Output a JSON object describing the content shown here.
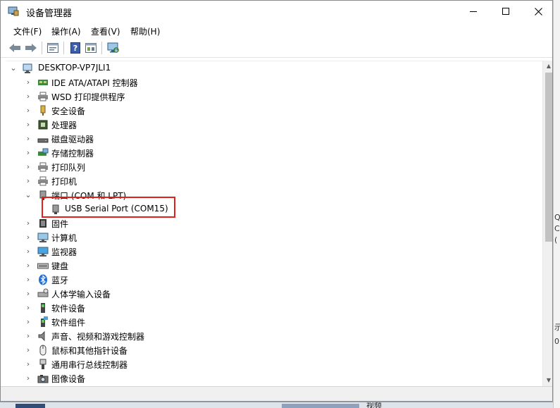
{
  "window": {
    "title": "设备管理器"
  },
  "menu": [
    {
      "label": "文件(F)"
    },
    {
      "label": "操作(A)"
    },
    {
      "label": "查看(V)"
    },
    {
      "label": "帮助(H)"
    }
  ],
  "toolbar": [
    {
      "icon": "back-arrow-icon"
    },
    {
      "icon": "forward-arrow-icon"
    },
    {
      "icon": "properties-icon"
    },
    {
      "icon": "help-icon"
    },
    {
      "icon": "show-hidden-icon"
    },
    {
      "icon": "scan-hardware-icon"
    }
  ],
  "tree": {
    "root": "DESKTOP-VP7JLI1",
    "items": [
      {
        "label": "IDE ATA/ATAPI 控制器",
        "expanded": false,
        "icon": "ide-controller-icon"
      },
      {
        "label": "WSD 打印提供程序",
        "expanded": false,
        "icon": "printer-icon"
      },
      {
        "label": "安全设备",
        "expanded": false,
        "icon": "security-key-icon"
      },
      {
        "label": "处理器",
        "expanded": false,
        "icon": "cpu-icon"
      },
      {
        "label": "磁盘驱动器",
        "expanded": false,
        "icon": "disk-icon"
      },
      {
        "label": "存储控制器",
        "expanded": false,
        "icon": "storage-icon"
      },
      {
        "label": "打印队列",
        "expanded": false,
        "icon": "printer-icon"
      },
      {
        "label": "打印机",
        "expanded": false,
        "icon": "printer-icon"
      },
      {
        "label": "端口 (COM 和 LPT)",
        "expanded": true,
        "icon": "port-icon"
      },
      {
        "label": "固件",
        "expanded": false,
        "icon": "firmware-icon"
      },
      {
        "label": "计算机",
        "expanded": false,
        "icon": "computer-icon"
      },
      {
        "label": "监视器",
        "expanded": false,
        "icon": "monitor-icon"
      },
      {
        "label": "键盘",
        "expanded": false,
        "icon": "keyboard-icon"
      },
      {
        "label": "蓝牙",
        "expanded": false,
        "icon": "bluetooth-icon"
      },
      {
        "label": "人体学输入设备",
        "expanded": false,
        "icon": "hid-icon"
      },
      {
        "label": "软件设备",
        "expanded": false,
        "icon": "software-device-icon"
      },
      {
        "label": "软件组件",
        "expanded": false,
        "icon": "software-component-icon"
      },
      {
        "label": "声音、视频和游戏控制器",
        "expanded": false,
        "icon": "speaker-icon"
      },
      {
        "label": "鼠标和其他指针设备",
        "expanded": false,
        "icon": "mouse-icon"
      },
      {
        "label": "通用串行总线控制器",
        "expanded": false,
        "icon": "usb-icon"
      },
      {
        "label": "图像设备",
        "expanded": false,
        "icon": "camera-icon"
      }
    ],
    "port_child": {
      "label": "USB Serial Port (COM15)"
    }
  },
  "background": {
    "taskbar_text": "视频",
    "right_edge_chars": [
      "Q",
      "C",
      "(",
      "示",
      "0"
    ]
  },
  "colors": {
    "highlight": "#e0201b",
    "window_bg": "#ffffff",
    "desktop": "#5b6f86"
  }
}
